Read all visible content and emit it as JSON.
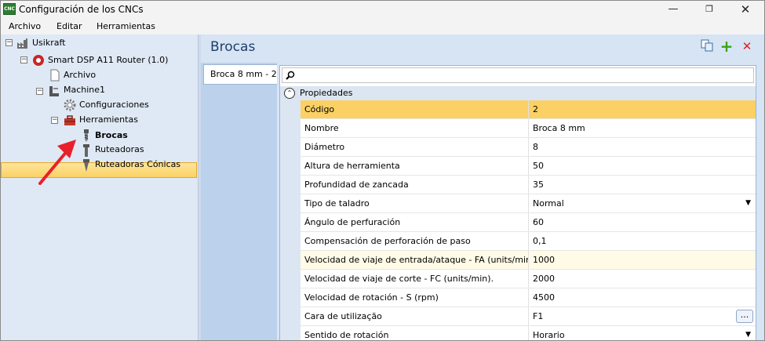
{
  "window": {
    "title": "Configuración de los CNCs",
    "icon_text": "CNC"
  },
  "menu": [
    "Archivo",
    "Editar",
    "Herramientas"
  ],
  "tree": {
    "root": "Usikraft",
    "machine_type": "Smart DSP A11 Router (1.0)",
    "archivo": "Archivo",
    "machine": "Machine1",
    "config": "Configuraciones",
    "tools": "Herramientas",
    "brocas": "Brocas",
    "ruteadoras": "Ruteadoras",
    "conicas": "Ruteadoras Cónicas"
  },
  "panel": {
    "title": "Brocas",
    "tab": "Broca 8 mm - 2",
    "section": "Propiedades"
  },
  "properties": [
    {
      "name": "Código",
      "value": "2"
    },
    {
      "name": "Nombre",
      "value": "Broca 8 mm"
    },
    {
      "name": "Diámetro",
      "value": "8"
    },
    {
      "name": "Altura de herramienta",
      "value": "50"
    },
    {
      "name": "Profundidad de zancada",
      "value": "35"
    },
    {
      "name": "Tipo de taladro",
      "value": "Normal"
    },
    {
      "name": "Ángulo de perfuración",
      "value": "60"
    },
    {
      "name": "Compensación de perforación de paso",
      "value": "0,1"
    },
    {
      "name": "Velocidad de viaje de entrada/ataque - FA (units/min)",
      "value": "1000"
    },
    {
      "name": "Velocidad de viaje de corte - FC (units/min).",
      "value": "2000"
    },
    {
      "name": "Velocidad de rotación - S (rpm)",
      "value": "4500"
    },
    {
      "name": "Cara de utilização",
      "value": "F1"
    },
    {
      "name": "Sentido de rotación",
      "value": "Horario"
    }
  ],
  "colors": {
    "selected": "#fbd165",
    "highlight_row": "#fffbe6",
    "tree_bg": "#dfe9f5",
    "arrow": "#e8202a"
  }
}
